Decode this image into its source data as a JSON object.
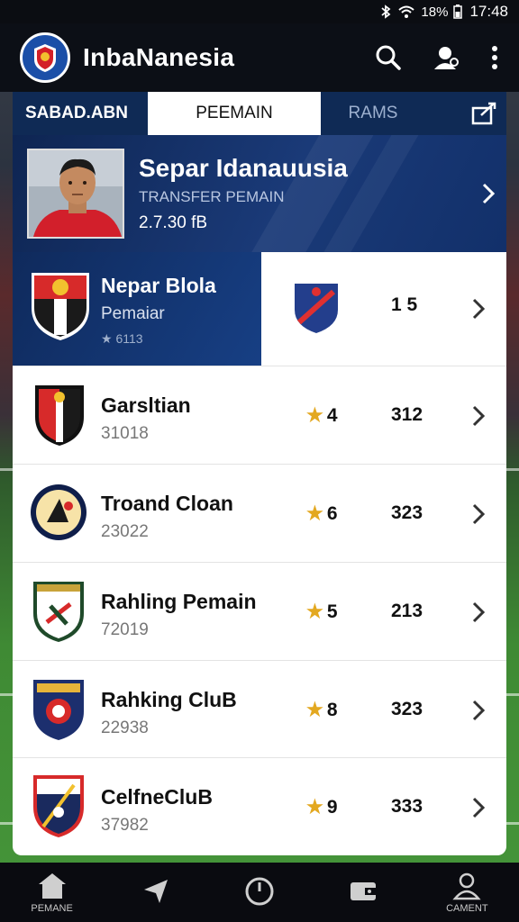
{
  "status_bar": {
    "time": "17:48",
    "battery": "18%",
    "icons": [
      "bluetooth-icon",
      "wifi-icon",
      "battery-icon"
    ]
  },
  "app_bar": {
    "title": "InbaNanesia",
    "icons": [
      "search-icon",
      "profile-icon",
      "more-icon"
    ]
  },
  "tabs": [
    {
      "label": "SABAD.ABN",
      "selected": false
    },
    {
      "label": "PEEMAIN",
      "selected": true
    },
    {
      "label": "RAMS",
      "selected": false
    }
  ],
  "featured": {
    "title": "Separ Idanauusia",
    "subtitle": "TRANSFER PEMAIN",
    "value": "2.7.30 fB"
  },
  "list": [
    {
      "name": "Nepar Blola",
      "sub": "Pemaiar",
      "meta": "★ 6113",
      "rating": "",
      "count": "1 5",
      "highlight": true
    },
    {
      "name": "Garsltian",
      "sub": "31018",
      "rating": "4",
      "count": "312",
      "highlight": false
    },
    {
      "name": "Troand Cloan",
      "sub": "23022",
      "rating": "6",
      "count": "323",
      "highlight": false
    },
    {
      "name": "Rahling Pemain",
      "sub": "72019",
      "rating": "5",
      "count": "213",
      "highlight": false
    },
    {
      "name": "Rahking CluB",
      "sub": "22938",
      "rating": "8",
      "count": "323",
      "highlight": false
    },
    {
      "name": "CelfneCluB",
      "sub": "37982",
      "rating": "9",
      "count": "333",
      "highlight": false
    }
  ],
  "bottom_nav": [
    {
      "label": "PEMANE",
      "icon": "home-icon"
    },
    {
      "label": "",
      "icon": "send-icon"
    },
    {
      "label": "",
      "icon": "clock-icon"
    },
    {
      "label": "",
      "icon": "wallet-icon"
    },
    {
      "label": "CAMENT",
      "icon": "user-icon"
    }
  ],
  "colors": {
    "navy": "#0f2a55",
    "accent_star": "#e3a820",
    "list_bg": "#ffffff"
  }
}
